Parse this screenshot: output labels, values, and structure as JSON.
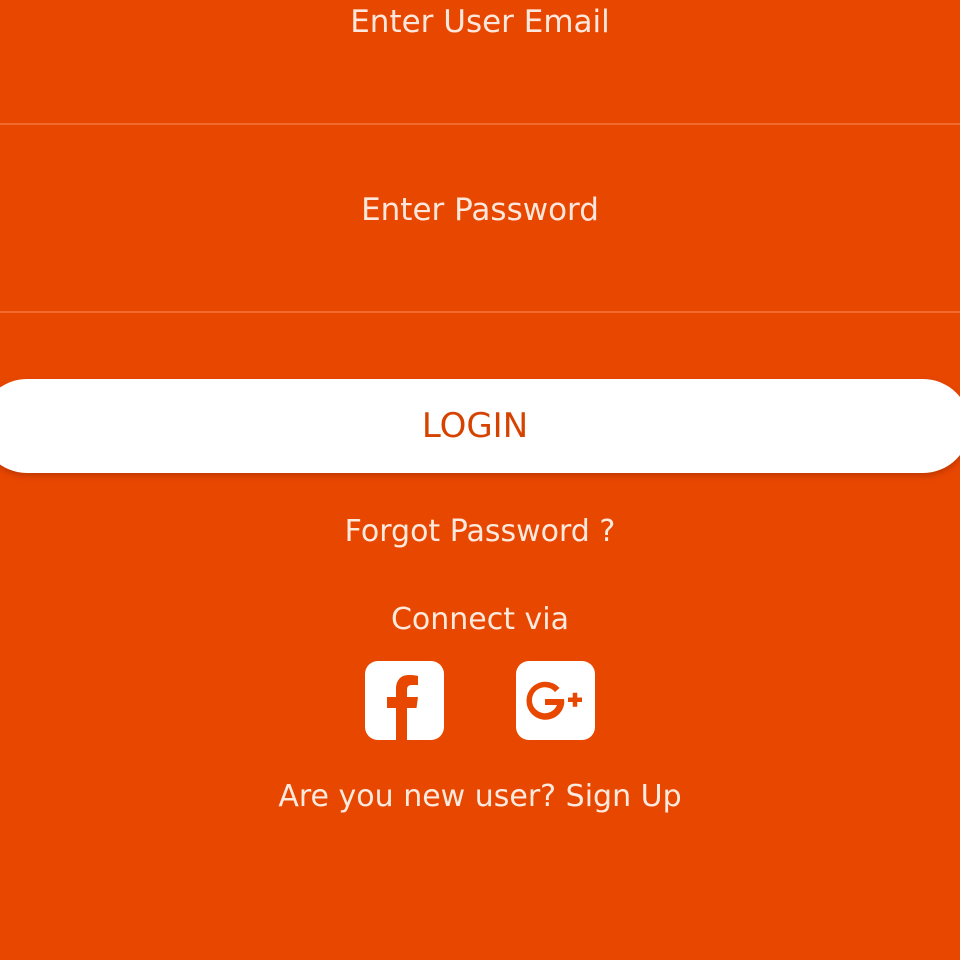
{
  "form": {
    "email": {
      "placeholder": "Enter User Email",
      "value": ""
    },
    "password": {
      "placeholder": "Enter Password",
      "value": ""
    },
    "login_label": "LOGIN",
    "forgot_label": "Forgot Password ?"
  },
  "social": {
    "heading": "Connect via",
    "providers": [
      {
        "name": "facebook",
        "icon": "facebook-icon"
      },
      {
        "name": "google-plus",
        "icon": "google-plus-icon"
      }
    ]
  },
  "signup": {
    "label": "Are you new user? Sign Up"
  },
  "colors": {
    "background": "#e84700",
    "button_background": "#ffffff",
    "button_text": "#d64200",
    "divider": "#f26a2e"
  }
}
